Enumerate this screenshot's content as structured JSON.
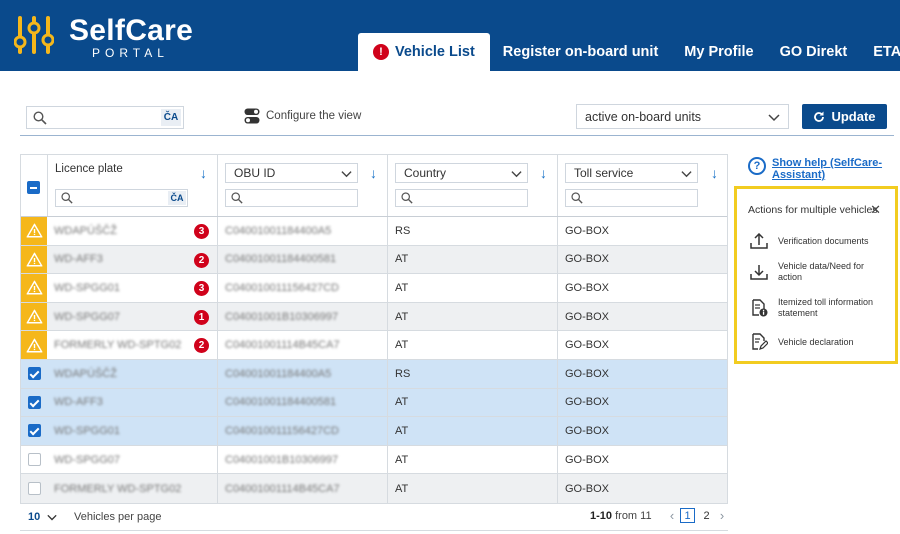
{
  "brand": {
    "title": "SelfCare",
    "subtitle": "PORTAL"
  },
  "nav": {
    "tabs": [
      {
        "label": "Vehicle List",
        "alert": "!"
      },
      {
        "label": "Register on-board unit"
      },
      {
        "label": "My Profile"
      },
      {
        "label": "GO Direkt"
      },
      {
        "label": "ETA"
      }
    ]
  },
  "toolbar": {
    "search_value": "",
    "ca_label": "ČA",
    "configure_label": "Configure the view",
    "filter_value": "active on-board units",
    "update_label": "Update"
  },
  "table": {
    "headers": {
      "licence_plate": "Licence plate",
      "obu_id": "OBU ID",
      "country": "Country",
      "toll_service": "Toll service"
    },
    "rows": [
      {
        "plate": "WDAPÚŠČŽ",
        "badge": "3",
        "obu": "C04001001184400A5",
        "country": "RS",
        "toll": "GO-BOX",
        "warn": true,
        "checked": false
      },
      {
        "plate": "WD-AFF3",
        "badge": "2",
        "obu": "C04001001184400581",
        "country": "AT",
        "toll": "GO-BOX",
        "warn": true,
        "checked": false
      },
      {
        "plate": "WD-SPGG01",
        "badge": "3",
        "obu": "C040010011156427CD",
        "country": "AT",
        "toll": "GO-BOX",
        "warn": true,
        "checked": false
      },
      {
        "plate": "WD-SPGG07",
        "badge": "1",
        "obu": "C04001001B10306997",
        "country": "AT",
        "toll": "GO-BOX",
        "warn": true,
        "checked": false
      },
      {
        "plate": "FORMERLY WD-SPTG02",
        "badge": "2",
        "obu": "C04001001114B45CA7",
        "country": "AT",
        "toll": "GO-BOX",
        "warn": true,
        "checked": false
      },
      {
        "plate": "WDAPÚŠČŽ",
        "badge": "",
        "obu": "C04001001184400A5",
        "country": "RS",
        "toll": "GO-BOX",
        "warn": false,
        "checked": true
      },
      {
        "plate": "WD-AFF3",
        "badge": "",
        "obu": "C04001001184400581",
        "country": "AT",
        "toll": "GO-BOX",
        "warn": false,
        "checked": true
      },
      {
        "plate": "WD-SPGG01",
        "badge": "",
        "obu": "C040010011156427CD",
        "country": "AT",
        "toll": "GO-BOX",
        "warn": false,
        "checked": true
      },
      {
        "plate": "WD-SPGG07",
        "badge": "",
        "obu": "C04001001B10306997",
        "country": "AT",
        "toll": "GO-BOX",
        "warn": false,
        "checked": false
      },
      {
        "plate": "FORMERLY WD-SPTG02",
        "badge": "",
        "obu": "C04001001114B45CA7",
        "country": "AT",
        "toll": "GO-BOX",
        "warn": false,
        "checked": false
      }
    ]
  },
  "footer": {
    "per_page_value": "10",
    "per_page_label": "Vehicles per page",
    "range": "1-10",
    "range_suffix": "from 11",
    "pages": [
      "1",
      "2"
    ]
  },
  "side": {
    "help_link": "Show help (SelfCare-Assistant)",
    "actions_title": "Actions for multiple vehicles",
    "actions": [
      {
        "label": "Verification documents",
        "icon": "upload-icon"
      },
      {
        "label": "Vehicle data/Need for action",
        "icon": "download-icon"
      },
      {
        "label": "Itemized toll information statement",
        "icon": "document-info-icon"
      },
      {
        "label": "Vehicle declaration",
        "icon": "document-edit-icon"
      }
    ]
  },
  "colors": {
    "brand_blue": "#0a4a8c",
    "warning_yellow": "#f5b71b",
    "badge_red": "#d0021b",
    "selected_row": "#cfe3f6",
    "panel_border": "#f2cc20"
  }
}
